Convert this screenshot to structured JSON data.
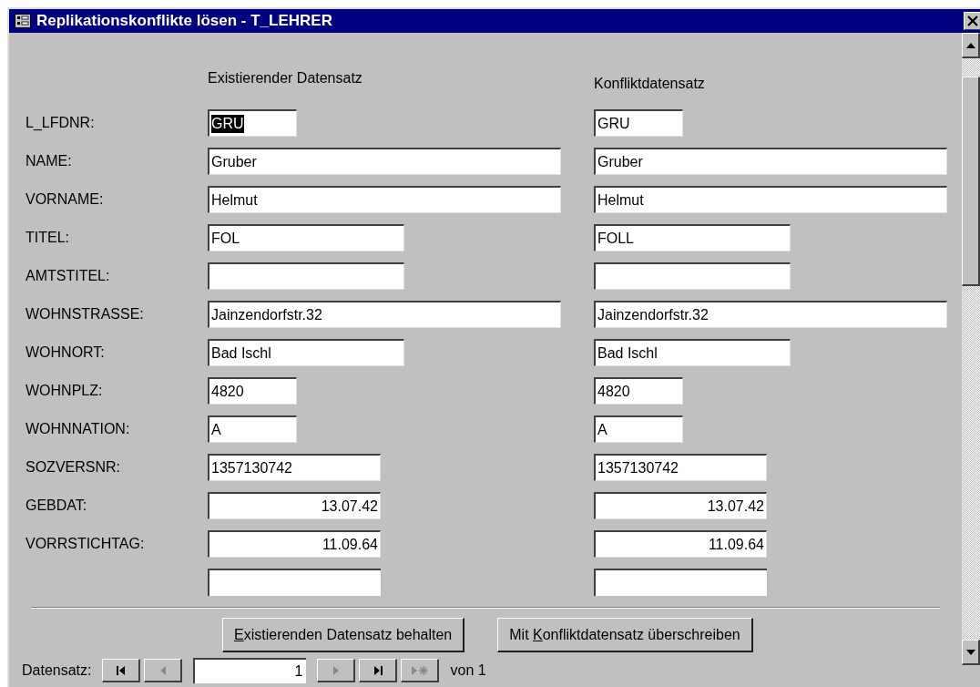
{
  "window": {
    "title": "Replikationskonflikte lösen - T_LEHRER"
  },
  "columns": [
    "Existierender Datensatz",
    "Konfliktdatensatz"
  ],
  "rows": [
    {
      "label": "L_LFDNR:",
      "kind": "code",
      "existing": {
        "value": "GRU",
        "selected": true
      },
      "conflict": {
        "value": "GRU",
        "selected": false
      }
    },
    {
      "label": "NAME:",
      "kind": "long",
      "existing": {
        "value": "Gruber",
        "selected": false
      },
      "conflict": {
        "value": "Gruber",
        "selected": false
      }
    },
    {
      "label": "VORNAME:",
      "kind": "long",
      "existing": {
        "value": "Helmut",
        "selected": false
      },
      "conflict": {
        "value": "Helmut",
        "selected": false
      }
    },
    {
      "label": "TITEL:",
      "kind": "medium",
      "existing": {
        "value": "FOL",
        "selected": false
      },
      "conflict": {
        "value": "FOLL",
        "selected": false
      }
    },
    {
      "label": "AMTSTITEL:",
      "kind": "medium",
      "existing": {},
      "conflict": {}
    },
    {
      "label": "WOHNSTRASSE:",
      "kind": "long",
      "existing": {
        "value": "Jainzendorfstr.32",
        "selected": false
      },
      "conflict": {
        "value": "Jainzendorfstr.32",
        "selected": false
      }
    },
    {
      "label": "WOHNORT:",
      "kind": "medium",
      "existing": {
        "value": "Bad Ischl",
        "selected": false
      },
      "conflict": {
        "value": "Bad Ischl",
        "selected": false
      }
    },
    {
      "label": "WOHNPLZ:",
      "kind": "code",
      "existing": {
        "value": "4820",
        "selected": false
      },
      "conflict": {
        "value": "4820",
        "selected": false
      }
    },
    {
      "label": "WOHNNATION:",
      "kind": "code",
      "existing": {
        "value": "A",
        "selected": false
      },
      "conflict": {
        "value": "A",
        "selected": false
      }
    },
    {
      "label": "SOZVERSNR:",
      "kind": "number",
      "existing": {
        "value": "1357130742",
        "selected": false
      },
      "conflict": {
        "value": "1357130742",
        "selected": false
      }
    },
    {
      "label": "GEBDAT:",
      "kind": "date",
      "existing": {
        "value": "13.07.42",
        "selected": false
      },
      "conflict": {
        "value": "13.07.42",
        "selected": false
      }
    },
    {
      "label": "VORRSTICHTAG:",
      "kind": "date",
      "existing": {
        "value": "11.09.64",
        "selected": false
      },
      "conflict": {
        "value": "11.09.64",
        "selected": false
      }
    }
  ],
  "buttons": [
    {
      "key": "E",
      "post": "xistierenden Datensatz behalten"
    },
    {
      "pre": "Mit ",
      "key": "K",
      "post": "onfliktdatensatz überschreiben"
    }
  ],
  "navigation": {
    "label": "Datensatz:",
    "buttons_before": [
      {
        "kind": "first",
        "disabled": false
      },
      {
        "kind": "previous",
        "disabled": true
      }
    ],
    "current": "1",
    "buttons_after": [
      {
        "kind": "next",
        "disabled": true
      },
      {
        "kind": "last",
        "disabled": false
      },
      {
        "kind": "new",
        "disabled": true
      }
    ],
    "total": "von 1"
  }
}
